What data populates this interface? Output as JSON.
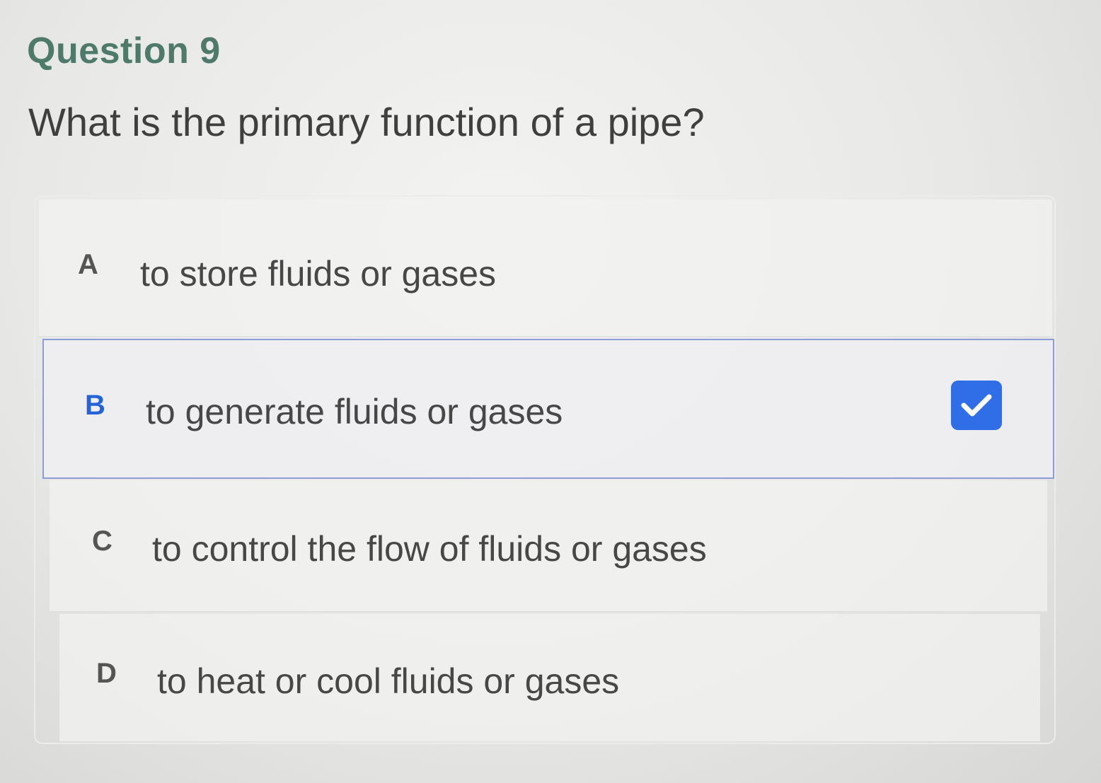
{
  "question": {
    "title": "Question 9",
    "prompt": "What is the primary function of a pipe?"
  },
  "options": [
    {
      "letter": "A",
      "text": "to store fluids or gases",
      "selected": false
    },
    {
      "letter": "B",
      "text": "to generate fluids or gases",
      "selected": true
    },
    {
      "letter": "C",
      "text": "to control the flow of fluids or gases",
      "selected": false
    },
    {
      "letter": "D",
      "text": "to heat or cool fluids or gases",
      "selected": false
    }
  ],
  "colors": {
    "title": "#4d7a6b",
    "selected_border": "#8c9ed8",
    "checkbox": "#2f6ee6"
  },
  "icons": {
    "selected_indicator": "checkmark-icon"
  }
}
